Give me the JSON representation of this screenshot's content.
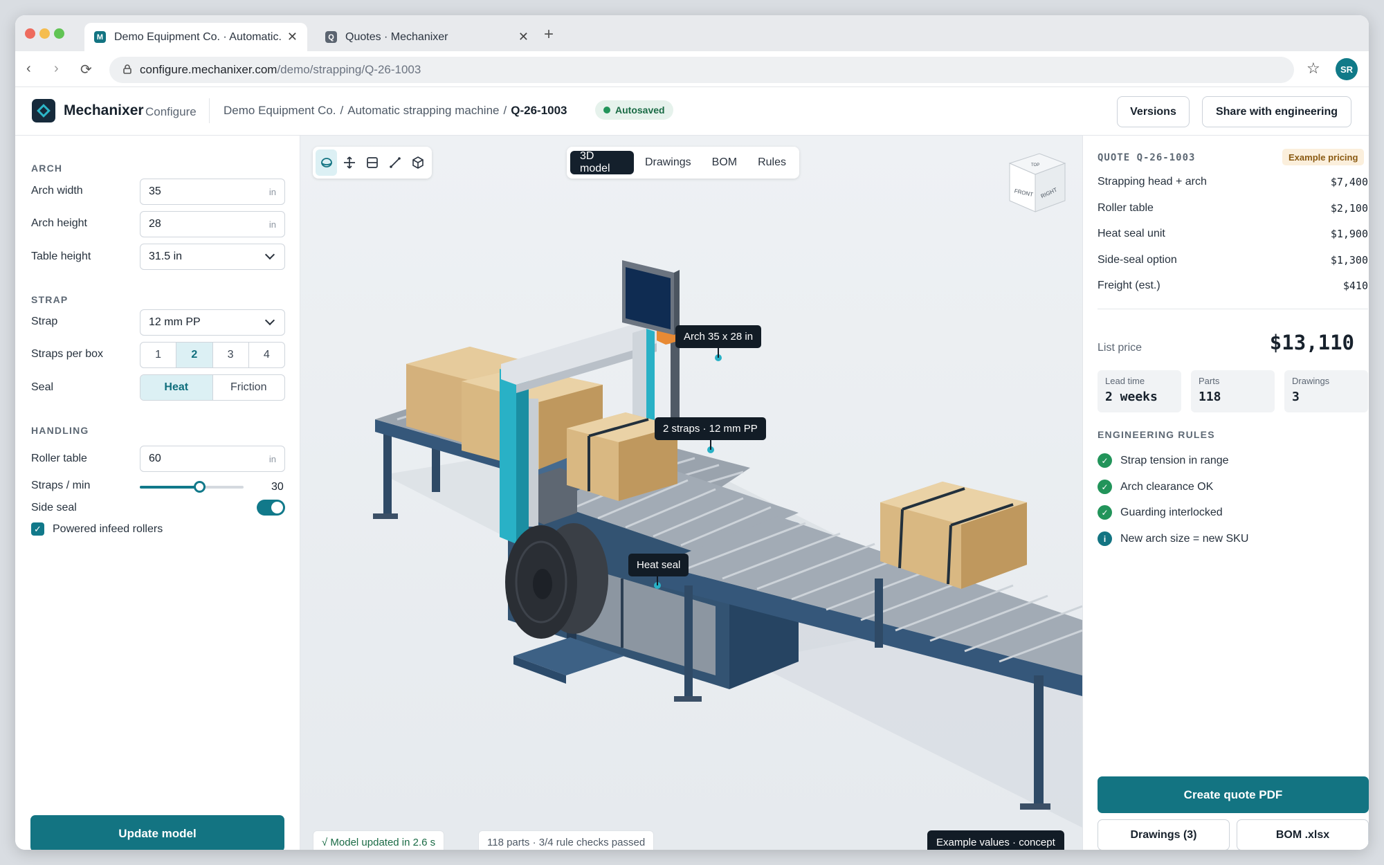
{
  "browser": {
    "tabs": [
      {
        "label": "Demo Equipment Co. · Automatic...",
        "favicon": "M",
        "favicon_color": "#137482"
      },
      {
        "label": "Quotes · Mechanixer",
        "favicon": "Q",
        "favicon_color": "#5b6470"
      }
    ],
    "url_host": "configure.mechanixer.com",
    "url_path": "/demo/strapping/Q-26-1003",
    "profile_initials": "SR"
  },
  "header": {
    "brand": "Mechanixer",
    "brand_sub": "Configure",
    "breadcrumb": [
      "Demo Equipment Co.",
      "/",
      "Automatic strapping machine",
      "/"
    ],
    "current": "Q-26-1003",
    "status": "Autosaved",
    "versions_label": "Versions",
    "share_label": "Share with engineering"
  },
  "config": {
    "arch": {
      "title": "ARCH",
      "width_label": "Arch width",
      "width_value": "35",
      "width_unit": "in",
      "height_label": "Arch height",
      "height_value": "28",
      "height_unit": "in",
      "table_label": "Table height",
      "table_value": "31.5 in"
    },
    "strap": {
      "title": "STRAP",
      "strap_label": "Strap",
      "strap_value": "12 mm PP",
      "per_box_label": "Straps per box",
      "per_box_options": [
        "1",
        "2",
        "3",
        "4"
      ],
      "per_box_selected": "2",
      "seal_label": "Seal",
      "seal_options": [
        "Heat",
        "Friction"
      ],
      "seal_selected": "Heat"
    },
    "handling": {
      "title": "HANDLING",
      "roller_label": "Roller table",
      "roller_value": "60",
      "roller_unit": "in",
      "rate_label": "Straps / min",
      "rate_value": "30",
      "rate_fraction": 0.57,
      "side_seal_label": "Side seal",
      "side_seal_on": true,
      "infeed_label": "Powered infeed rollers",
      "infeed_checked": true
    },
    "update_label": "Update model"
  },
  "viewport": {
    "tabs": [
      "3D model",
      "Drawings",
      "BOM",
      "Rules"
    ],
    "active_tab": "3D model",
    "tools": [
      "orbit-icon",
      "pan-icon",
      "section-icon",
      "measure-icon",
      "cube-icon"
    ],
    "callouts": {
      "arch": "Arch 35 x 28 in",
      "straps": "2 straps · 12 mm PP",
      "seal": "Heat seal"
    },
    "cube_faces": {
      "front": "FRONT",
      "right": "RIGHT",
      "top": "TOP"
    },
    "status_updated": "√ Model updated in 2.6 s",
    "status_parts": "118 parts · 3/4 rule checks passed",
    "status_example": "Example values · concept"
  },
  "quote": {
    "title": "QUOTE Q-26-1003",
    "badge": "Example pricing",
    "lines": [
      {
        "label": "Strapping head + arch",
        "amount": "$7,400"
      },
      {
        "label": "Roller table",
        "amount": "$2,100"
      },
      {
        "label": "Heat seal unit",
        "amount": "$1,900"
      },
      {
        "label": "Side-seal option",
        "amount": "$1,300"
      },
      {
        "label": "Freight (est.)",
        "amount": "$410"
      }
    ],
    "list_label": "List price",
    "list_price": "$13,110",
    "stats": [
      {
        "label": "Lead time",
        "value": "2 weeks"
      },
      {
        "label": "Parts",
        "value": "118"
      },
      {
        "label": "Drawings",
        "value": "3"
      }
    ],
    "rules_title": "ENGINEERING RULES",
    "rules": [
      {
        "text": "Strap tension in range",
        "status": "pass"
      },
      {
        "text": "Arch clearance OK",
        "status": "pass"
      },
      {
        "text": "Guarding interlocked",
        "status": "pass"
      },
      {
        "text": "New arch size = new SKU",
        "status": "info"
      }
    ],
    "pdf_label": "Create quote PDF",
    "drawings_label": "Drawings (3)",
    "bom_label": "BOM .xlsx"
  },
  "colors": {
    "accent": "#137482",
    "pass": "#22945a",
    "info": "#137482",
    "dark": "#121c26"
  }
}
